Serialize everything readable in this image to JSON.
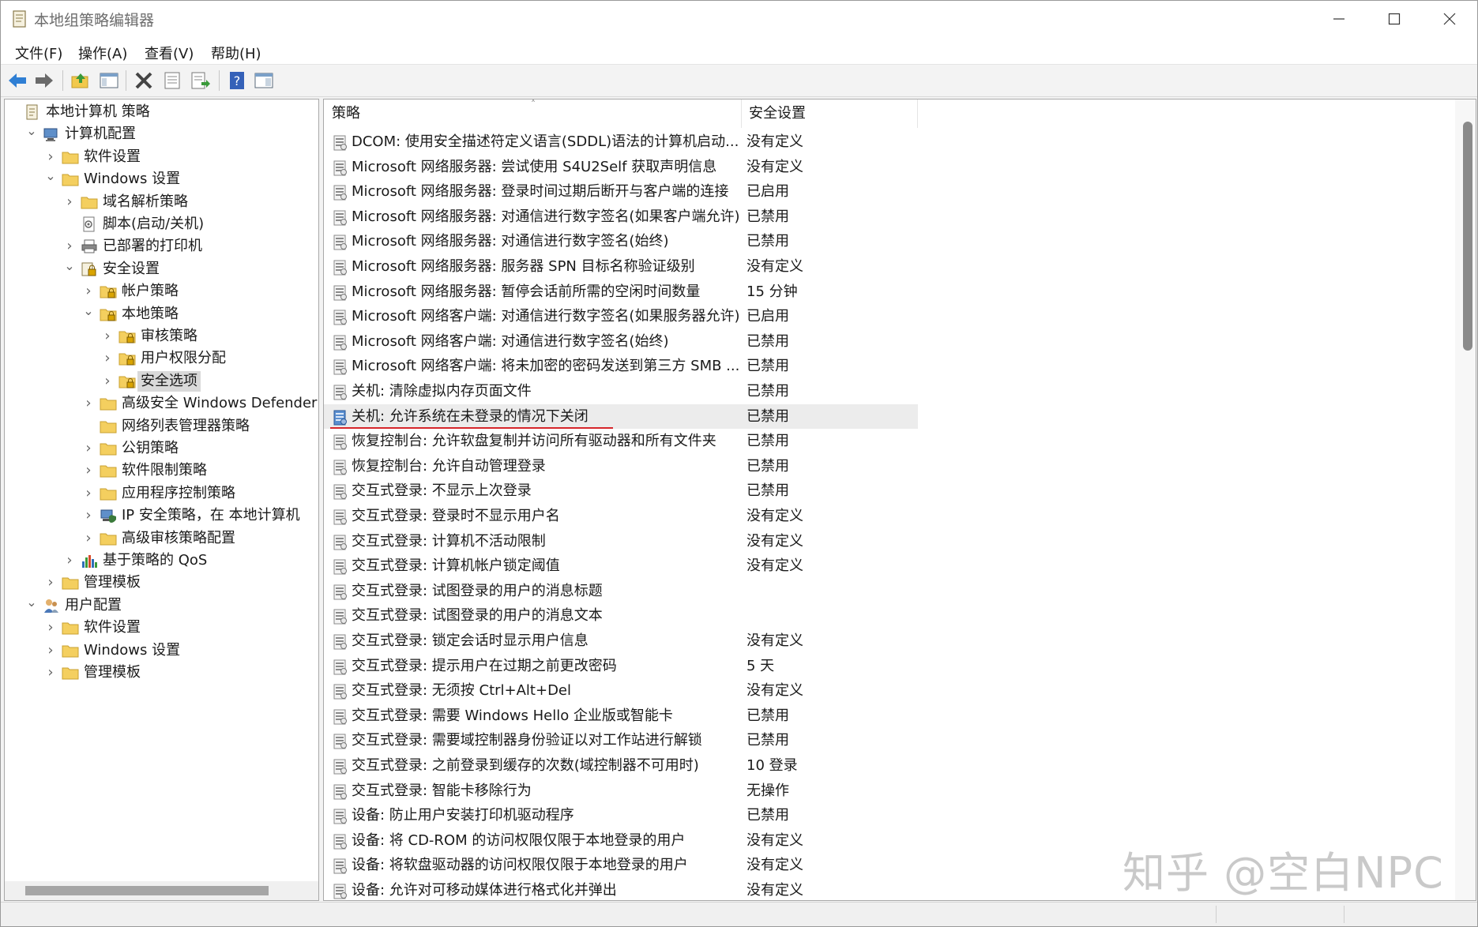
{
  "window": {
    "title": "本地组策略编辑器"
  },
  "menu": [
    {
      "label": "文件(F)"
    },
    {
      "label": "操作(A)"
    },
    {
      "label": "查看(V)"
    },
    {
      "label": "帮助(H)"
    }
  ],
  "toolbar": {
    "buttons": [
      {
        "icon": "back-arrow-icon"
      },
      {
        "icon": "forward-arrow-icon"
      },
      {
        "icon": "up-folder-icon"
      },
      {
        "icon": "show-hide-tree-icon"
      },
      {
        "icon": "delete-icon"
      },
      {
        "icon": "properties-icon"
      },
      {
        "icon": "export-list-icon"
      },
      {
        "icon": "help-icon"
      },
      {
        "icon": "action-pane-icon"
      }
    ]
  },
  "tree": {
    "items": [
      {
        "label": "本地计算机 策略",
        "icon": "policy-doc-icon",
        "depth": 0,
        "arrow": ""
      },
      {
        "label": "计算机配置",
        "icon": "computer-icon",
        "depth": 1,
        "arrow": "expanded"
      },
      {
        "label": "软件设置",
        "icon": "folder-icon",
        "depth": 2,
        "arrow": "collapsed"
      },
      {
        "label": "Windows 设置",
        "icon": "folder-icon",
        "depth": 2,
        "arrow": "expanded"
      },
      {
        "label": "域名解析策略",
        "icon": "folder-icon",
        "depth": 3,
        "arrow": "collapsed"
      },
      {
        "label": "脚本(启动/关机)",
        "icon": "script-icon",
        "depth": 3,
        "arrow": ""
      },
      {
        "label": "已部署的打印机",
        "icon": "printer-icon",
        "depth": 3,
        "arrow": "collapsed"
      },
      {
        "label": "安全设置",
        "icon": "security-settings-icon",
        "depth": 3,
        "arrow": "expanded"
      },
      {
        "label": "帐户策略",
        "icon": "lock-folder-icon",
        "depth": 4,
        "arrow": "collapsed"
      },
      {
        "label": "本地策略",
        "icon": "lock-folder-icon",
        "depth": 4,
        "arrow": "expanded"
      },
      {
        "label": "审核策略",
        "icon": "lock-folder-icon",
        "depth": 5,
        "arrow": "collapsed"
      },
      {
        "label": "用户权限分配",
        "icon": "lock-folder-icon",
        "depth": 5,
        "arrow": "collapsed"
      },
      {
        "label": "安全选项",
        "icon": "lock-folder-icon",
        "depth": 5,
        "arrow": "collapsed",
        "selected": true
      },
      {
        "label": "高级安全 Windows Defender 防火墙",
        "icon": "folder-icon",
        "depth": 4,
        "arrow": "collapsed"
      },
      {
        "label": "网络列表管理器策略",
        "icon": "folder-icon",
        "depth": 4,
        "arrow": ""
      },
      {
        "label": "公钥策略",
        "icon": "folder-icon",
        "depth": 4,
        "arrow": "collapsed"
      },
      {
        "label": "软件限制策略",
        "icon": "folder-icon",
        "depth": 4,
        "arrow": "collapsed"
      },
      {
        "label": "应用程序控制策略",
        "icon": "folder-icon",
        "depth": 4,
        "arrow": "collapsed"
      },
      {
        "label": "IP 安全策略，在 本地计算机",
        "icon": "ip-security-icon",
        "depth": 4,
        "arrow": "collapsed"
      },
      {
        "label": "高级审核策略配置",
        "icon": "folder-icon",
        "depth": 4,
        "arrow": "collapsed"
      },
      {
        "label": "基于策略的 QoS",
        "icon": "qos-chart-icon",
        "depth": 3,
        "arrow": "collapsed"
      },
      {
        "label": "管理模板",
        "icon": "folder-icon",
        "depth": 2,
        "arrow": "collapsed"
      },
      {
        "label": "用户配置",
        "icon": "user-icon",
        "depth": 1,
        "arrow": "expanded"
      },
      {
        "label": "软件设置",
        "icon": "folder-icon",
        "depth": 2,
        "arrow": "collapsed"
      },
      {
        "label": "Windows 设置",
        "icon": "folder-icon",
        "depth": 2,
        "arrow": "collapsed"
      },
      {
        "label": "管理模板",
        "icon": "folder-icon",
        "depth": 2,
        "arrow": "collapsed"
      }
    ]
  },
  "list": {
    "columns": {
      "policy": "策略",
      "setting": "安全设置"
    },
    "rows": [
      {
        "policy": "DCOM: 使用安全描述符定义语言(SDDL)语法的计算机启动...",
        "setting": "没有定义"
      },
      {
        "policy": "Microsoft 网络服务器: 尝试使用 S4U2Self 获取声明信息",
        "setting": "没有定义"
      },
      {
        "policy": "Microsoft 网络服务器: 登录时间过期后断开与客户端的连接",
        "setting": "已启用"
      },
      {
        "policy": "Microsoft 网络服务器: 对通信进行数字签名(如果客户端允许)",
        "setting": "已禁用"
      },
      {
        "policy": "Microsoft 网络服务器: 对通信进行数字签名(始终)",
        "setting": "已禁用"
      },
      {
        "policy": "Microsoft 网络服务器: 服务器 SPN 目标名称验证级别",
        "setting": "没有定义"
      },
      {
        "policy": "Microsoft 网络服务器: 暂停会话前所需的空闲时间数量",
        "setting": "15 分钟"
      },
      {
        "policy": "Microsoft 网络客户端: 对通信进行数字签名(如果服务器允许)",
        "setting": "已启用"
      },
      {
        "policy": "Microsoft 网络客户端: 对通信进行数字签名(始终)",
        "setting": "已禁用"
      },
      {
        "policy": "Microsoft 网络客户端: 将未加密的密码发送到第三方 SMB ...",
        "setting": "已禁用"
      },
      {
        "policy": "关机: 清除虚拟内存页面文件",
        "setting": "已禁用"
      },
      {
        "policy": "关机: 允许系统在未登录的情况下关闭",
        "setting": "已禁用",
        "highlight": true
      },
      {
        "policy": "恢复控制台: 允许软盘复制并访问所有驱动器和所有文件夹",
        "setting": "已禁用"
      },
      {
        "policy": "恢复控制台: 允许自动管理登录",
        "setting": "已禁用"
      },
      {
        "policy": "交互式登录: 不显示上次登录",
        "setting": "已禁用"
      },
      {
        "policy": "交互式登录: 登录时不显示用户名",
        "setting": "没有定义"
      },
      {
        "policy": "交互式登录: 计算机不活动限制",
        "setting": "没有定义"
      },
      {
        "policy": "交互式登录: 计算机帐户锁定阈值",
        "setting": "没有定义"
      },
      {
        "policy": "交互式登录: 试图登录的用户的消息标题",
        "setting": ""
      },
      {
        "policy": "交互式登录: 试图登录的用户的消息文本",
        "setting": ""
      },
      {
        "policy": "交互式登录: 锁定会话时显示用户信息",
        "setting": "没有定义"
      },
      {
        "policy": "交互式登录: 提示用户在过期之前更改密码",
        "setting": "5 天"
      },
      {
        "policy": "交互式登录: 无须按 Ctrl+Alt+Del",
        "setting": "没有定义"
      },
      {
        "policy": "交互式登录: 需要 Windows Hello 企业版或智能卡",
        "setting": "已禁用"
      },
      {
        "policy": "交互式登录: 需要域控制器身份验证以对工作站进行解锁",
        "setting": "已禁用"
      },
      {
        "policy": "交互式登录: 之前登录到缓存的次数(域控制器不可用时)",
        "setting": "10 登录"
      },
      {
        "policy": "交互式登录: 智能卡移除行为",
        "setting": "无操作"
      },
      {
        "policy": "设备: 防止用户安装打印机驱动程序",
        "setting": "已禁用"
      },
      {
        "policy": "设备: 将 CD-ROM 的访问权限仅限于本地登录的用户",
        "setting": "没有定义"
      },
      {
        "policy": "设备: 将软盘驱动器的访问权限仅限于本地登录的用户",
        "setting": "没有定义"
      },
      {
        "policy": "设备: 允许对可移动媒体进行格式化并弹出",
        "setting": "没有定义"
      }
    ]
  },
  "watermark": "知乎 @空白NPC",
  "colors": {
    "highlight_underline": "#d6262b",
    "selected_bg": "#d9d9d9"
  }
}
